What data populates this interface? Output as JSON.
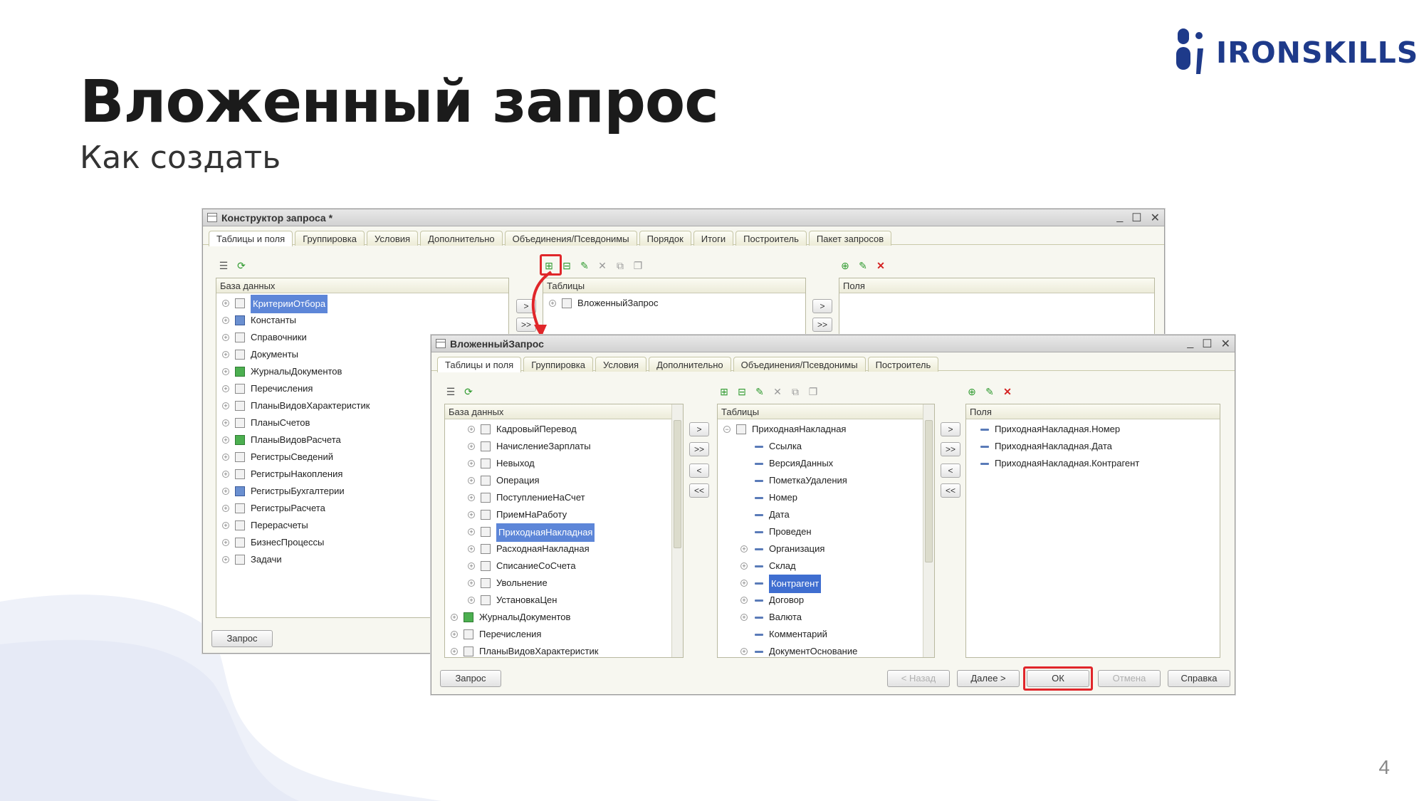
{
  "slide": {
    "title": "Вложенный запрос",
    "subtitle": "Как создать",
    "page_number": "4"
  },
  "logo": {
    "text": "IRONSKILLS",
    "color": "#1e3a8a"
  },
  "back_window": {
    "title": "Конструктор запроса *",
    "tabs": [
      "Таблицы и поля",
      "Группировка",
      "Условия",
      "Дополнительно",
      "Объединения/Псевдонимы",
      "Порядок",
      "Итоги",
      "Построитель",
      "Пакет запросов"
    ],
    "db_header": "База данных",
    "tables_header": "Таблицы",
    "fields_header": "Поля",
    "db_items": [
      "КритерииОтбора",
      "Константы",
      "Справочники",
      "Документы",
      "ЖурналыДокументов",
      "Перечисления",
      "ПланыВидовХарактеристик",
      "ПланыСчетов",
      "ПланыВидовРасчета",
      "РегистрыСведений",
      "РегистрыНакопления",
      "РегистрыБухгалтерии",
      "РегистрыРасчета",
      "Перерасчеты",
      "БизнесПроцессы",
      "Задачи"
    ],
    "tables_items": [
      "ВложенныйЗапрос"
    ],
    "query_button": "Запрос"
  },
  "front_window": {
    "title": "ВложенныйЗапрос",
    "tabs": [
      "Таблицы и поля",
      "Группировка",
      "Условия",
      "Дополнительно",
      "Объединения/Псевдонимы",
      "Построитель"
    ],
    "db_header": "База данных",
    "tables_header": "Таблицы",
    "fields_header": "Поля",
    "db_items": [
      "КадровыйПеревод",
      "НачислениеЗарплаты",
      "Невыход",
      "Операция",
      "ПоступлениеНаСчет",
      "ПриемНаРаботу",
      "ПриходнаяНакладная",
      "РасходнаяНакладная",
      "СписаниеСоСчета",
      "Увольнение",
      "УстановкаЦен",
      "ЖурналыДокументов",
      "Перечисления",
      "ПланыВидовХарактеристик"
    ],
    "tables_root": "ПриходнаяНакладная",
    "tables_items": [
      "Ссылка",
      "ВерсияДанных",
      "ПометкаУдаления",
      "Номер",
      "Дата",
      "Проведен",
      "Организация",
      "Склад",
      "Контрагент",
      "Договор",
      "Валюта",
      "Комментарий",
      "ДокументОснование"
    ],
    "fields_items": [
      "ПриходнаяНакладная.Номер",
      "ПриходнаяНакладная.Дата",
      "ПриходнаяНакладная.Контрагент"
    ],
    "buttons": {
      "query": "Запрос",
      "back": "< Назад",
      "next": "Далее >",
      "ok": "ОК",
      "cancel": "Отмена",
      "help": "Справка"
    }
  },
  "arrow_labels": {
    "right": ">",
    "right_all": ">>",
    "left": "<",
    "left_all": "<<"
  },
  "window_controls": {
    "minimize": "_",
    "maximize": "☐",
    "close": "✕"
  },
  "colors": {
    "highlight": "#e0262a",
    "selection": "#3f6ed0",
    "blob": "#eef1f9"
  }
}
